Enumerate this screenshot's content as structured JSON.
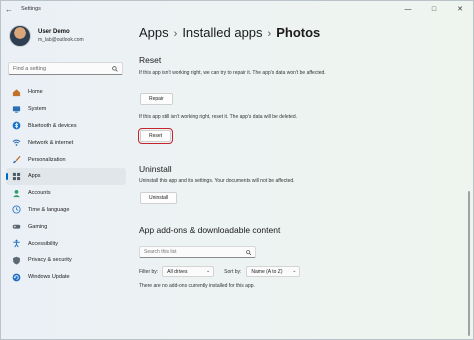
{
  "window": {
    "title": "Settings",
    "back_icon": "arrow-left-icon",
    "controls": [
      "—",
      "□",
      "✕"
    ]
  },
  "profile": {
    "name": "User Demo",
    "email": "m_lab@outlook.com"
  },
  "sidebar": {
    "search_placeholder": "Find a setting",
    "items": [
      {
        "label": "Home",
        "icon": "home-icon",
        "color": "#c2712a"
      },
      {
        "label": "System",
        "icon": "monitor-icon",
        "color": "#2d6fb5"
      },
      {
        "label": "Bluetooth & devices",
        "icon": "bluetooth-icon",
        "color": "#1a73c9"
      },
      {
        "label": "Network & internet",
        "icon": "wifi-icon",
        "color": "#2f6fb7"
      },
      {
        "label": "Personalization",
        "icon": "brush-icon",
        "color": "#b86a2a"
      },
      {
        "label": "Apps",
        "icon": "apps-icon",
        "color": "#4e5b66",
        "active": true
      },
      {
        "label": "Accounts",
        "icon": "person-icon",
        "color": "#2fa06a"
      },
      {
        "label": "Time & language",
        "icon": "globe-clock-icon",
        "color": "#2e78c2"
      },
      {
        "label": "Gaming",
        "icon": "gamepad-icon",
        "color": "#5a6570"
      },
      {
        "label": "Accessibility",
        "icon": "accessibility-icon",
        "color": "#1d6fc0"
      },
      {
        "label": "Privacy & security",
        "icon": "shield-icon",
        "color": "#5d6a75"
      },
      {
        "label": "Windows Update",
        "icon": "update-icon",
        "color": "#1f6fc4"
      }
    ]
  },
  "breadcrumb": {
    "items": [
      "Apps",
      "Installed apps"
    ],
    "current": "Photos",
    "separator": "›"
  },
  "reset_section": {
    "heading": "Reset",
    "repair_text": "If this app isn't working right, we can try to repair it. The app's data won't be affected.",
    "repair_button": "Repair",
    "reset_text": "If this app still isn't working right, reset it. The app's data will be deleted.",
    "reset_button": "Reset"
  },
  "uninstall_section": {
    "heading": "Uninstall",
    "text": "Uninstall this app and its settings. Your documents will not be affected.",
    "button": "Uninstall"
  },
  "addons_section": {
    "heading": "App add-ons & downloadable content",
    "search_placeholder": "Search this list",
    "filter_label": "Filter by:",
    "filter_value": "All drives",
    "sort_label": "Sort by:",
    "sort_value": "Name (A to Z)",
    "empty_text": "There are no add-ons currently installed for this app."
  },
  "colors": {
    "accent": "#0067c0",
    "highlight_border": "#c4262e"
  }
}
